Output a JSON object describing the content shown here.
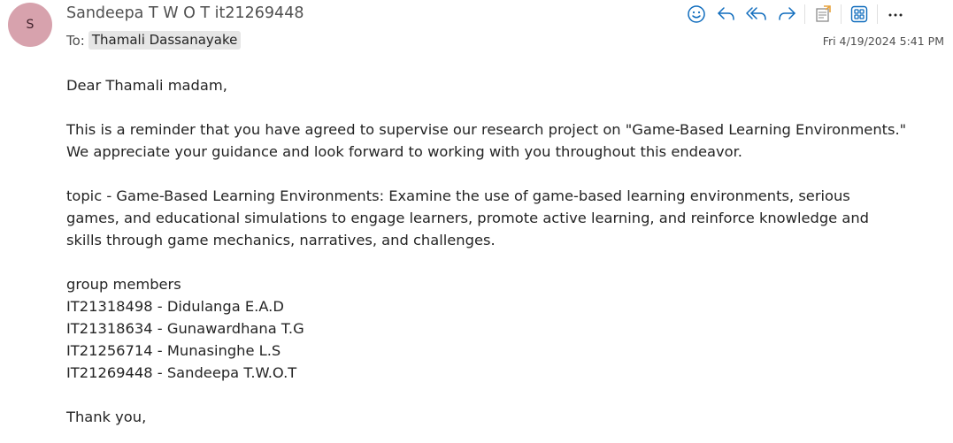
{
  "header": {
    "avatar_initial": "S",
    "sender": "Sandeepa T W O T it21269448",
    "to_label": "To:",
    "recipient": "Thamali Dassanayake",
    "date": "Fri 4/19/2024 5:41 PM"
  },
  "toolbar": {
    "icons": [
      "emoji-icon",
      "reply-icon",
      "reply-all-icon",
      "forward-icon",
      "sticky-note-icon",
      "apps-icon",
      "more-icon"
    ],
    "accent": "#0f6cbd"
  },
  "body": {
    "greeting": "Dear Thamali madam,",
    "para1_line1": "This is a reminder that you have agreed to supervise our research project on \"Game-Based Learning Environments.\"",
    "para1_line2": "We appreciate your guidance and look forward to working with you throughout this endeavor.",
    "topic_line1": "topic - Game-Based Learning Environments: Examine the use of game-based learning environments, serious",
    "topic_line2": "games, and educational simulations to engage learners, promote active learning, and reinforce knowledge and",
    "topic_line3": "skills through game mechanics, narratives, and challenges.",
    "members_heading": "group members",
    "members": [
      "IT21318498 - Didulanga E.A.D",
      "IT21318634 - Gunawardhana T.G",
      "IT21256714 - Munasinghe L.S",
      "IT21269448 - Sandeepa T.W.O.T"
    ],
    "closing": "Thank you,"
  }
}
